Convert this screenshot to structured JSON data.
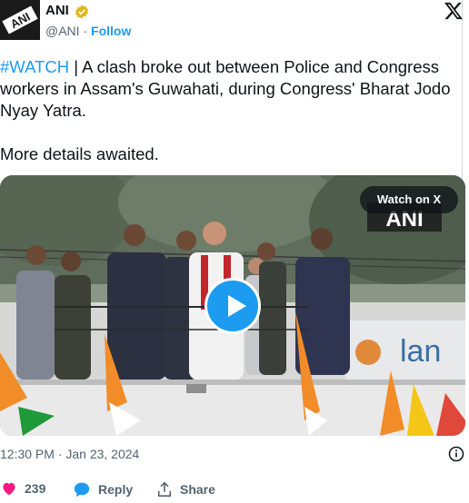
{
  "author": {
    "name": "ANI",
    "handle": "@ANI",
    "separator": " · ",
    "follow_label": "Follow",
    "avatar_text": "ANI",
    "verified_color": "#e2b719"
  },
  "tweet": {
    "hashtag": "#WATCH",
    "text_after_hashtag": " | A clash broke out between Police and Congress workers in Assam's Guwahati, during Congress' Bharat Jodo Nyay Yatra.",
    "text_second": "More details awaited."
  },
  "media": {
    "watch_label": "Watch on X",
    "watermark_text": "ANI",
    "banner_text": "lan"
  },
  "timestamp": "12:30 PM · Jan 23, 2024",
  "actions": {
    "like_count": "239",
    "reply_label": "Reply",
    "share_label": "Share"
  },
  "colors": {
    "accent": "#1d9bf0",
    "like": "#f91880",
    "muted": "#536471"
  },
  "icons": [
    "verified-badge-icon",
    "x-logo-icon",
    "play-icon",
    "info-icon",
    "heart-icon",
    "reply-bubble-icon",
    "share-icon"
  ]
}
